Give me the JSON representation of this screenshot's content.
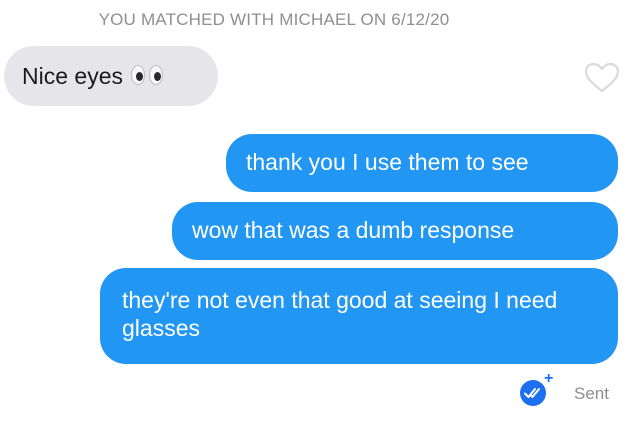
{
  "header": {
    "match_text": "YOU MATCHED WITH MICHAEL ON 6/12/20"
  },
  "messages": [
    {
      "direction": "incoming",
      "text": "Nice eyes",
      "emoji": "eyes-emoji"
    },
    {
      "direction": "outgoing",
      "text": "thank you I use them to see"
    },
    {
      "direction": "outgoing",
      "text": "wow that was a dumb response"
    },
    {
      "direction": "outgoing",
      "text": "they're not even that good at seeing I need glasses"
    }
  ],
  "receipt": {
    "status_label": "Sent",
    "plus_label": "+",
    "icon": "double-check-icon"
  },
  "icons": {
    "like": "heart-icon"
  },
  "colors": {
    "outgoing_bubble": "#2196f3",
    "incoming_bubble": "#e5e5ea",
    "meta_text": "#8e8e93",
    "read_badge": "#1e6ff0"
  }
}
